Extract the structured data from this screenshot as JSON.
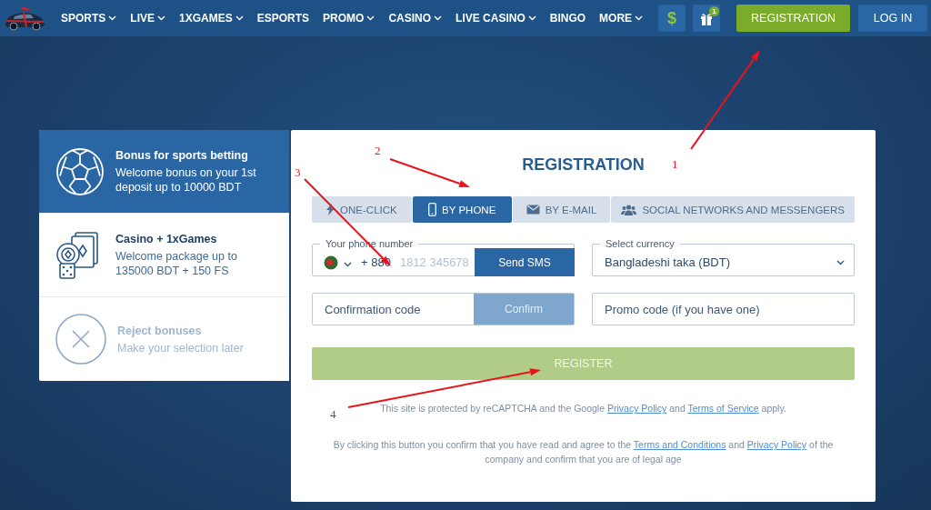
{
  "header": {
    "nav": [
      {
        "label": "SPORTS",
        "dropdown": true
      },
      {
        "label": "LIVE",
        "dropdown": true
      },
      {
        "label": "1XGAMES",
        "dropdown": true
      },
      {
        "label": "ESPORTS",
        "dropdown": false
      },
      {
        "label": "PROMO",
        "dropdown": true
      },
      {
        "label": "CASINO",
        "dropdown": true
      },
      {
        "label": "LIVE CASINO",
        "dropdown": true
      },
      {
        "label": "BINGO",
        "dropdown": false
      },
      {
        "label": "MORE",
        "dropdown": true
      }
    ],
    "currency_button": "$",
    "gift_badge": "1",
    "registration_button": "REGISTRATION",
    "login_button": "LOG IN"
  },
  "bonuses": [
    {
      "kind": "sports",
      "title": "Bonus for sports betting",
      "description": "Welcome bonus on your 1st deposit up to 10000 BDT",
      "selected": true
    },
    {
      "kind": "casino",
      "title": "Casino + 1xGames",
      "description": "Welcome package up to 135000 BDT + 150 FS",
      "selected": false
    },
    {
      "kind": "reject",
      "title": "Reject bonuses",
      "description": "Make your selection later",
      "selected": false
    }
  ],
  "registration": {
    "title": "REGISTRATION",
    "tabs": [
      {
        "kind": "one-click",
        "label": "ONE-CLICK",
        "selected": false
      },
      {
        "kind": "phone",
        "label": "BY PHONE",
        "selected": true
      },
      {
        "kind": "email",
        "label": "BY E-MAIL",
        "selected": false
      },
      {
        "kind": "social",
        "label": "SOCIAL NETWORKS AND MESSENGERS",
        "selected": false
      }
    ],
    "phone": {
      "label": "Your phone number",
      "country_code": "+ 880",
      "placeholder": "1812 345678"
    },
    "send_sms_button": "Send SMS",
    "currency": {
      "label": "Select currency",
      "value": "Bangladeshi taka (BDT)"
    },
    "confirmation": {
      "placeholder": "Confirmation code"
    },
    "confirm_button": {
      "label": "Confirm",
      "disabled": true
    },
    "promo": {
      "placeholder": "Promo code (if you have one)"
    },
    "register_button": {
      "label": "REGISTER",
      "disabled": true
    },
    "recaptcha_notice": [
      {
        "text": "This site is protected by reCAPTCHA and the Google "
      },
      {
        "text": "Privacy Policy",
        "link": true
      },
      {
        "text": " and "
      },
      {
        "text": "Terms of Service",
        "link": true
      },
      {
        "text": " apply."
      }
    ],
    "legal_notice": [
      {
        "text": "By clicking this button you confirm that you have read and agree to the "
      },
      {
        "text": "Terms and Conditions",
        "link": true
      },
      {
        "text": " and "
      },
      {
        "text": "Privacy Policy",
        "link": true
      },
      {
        "text": " of the company and confirm that you are of legal age"
      }
    ]
  },
  "annotations": [
    {
      "label": "1"
    },
    {
      "label": "2"
    },
    {
      "label": "3"
    },
    {
      "label": "4"
    }
  ]
}
